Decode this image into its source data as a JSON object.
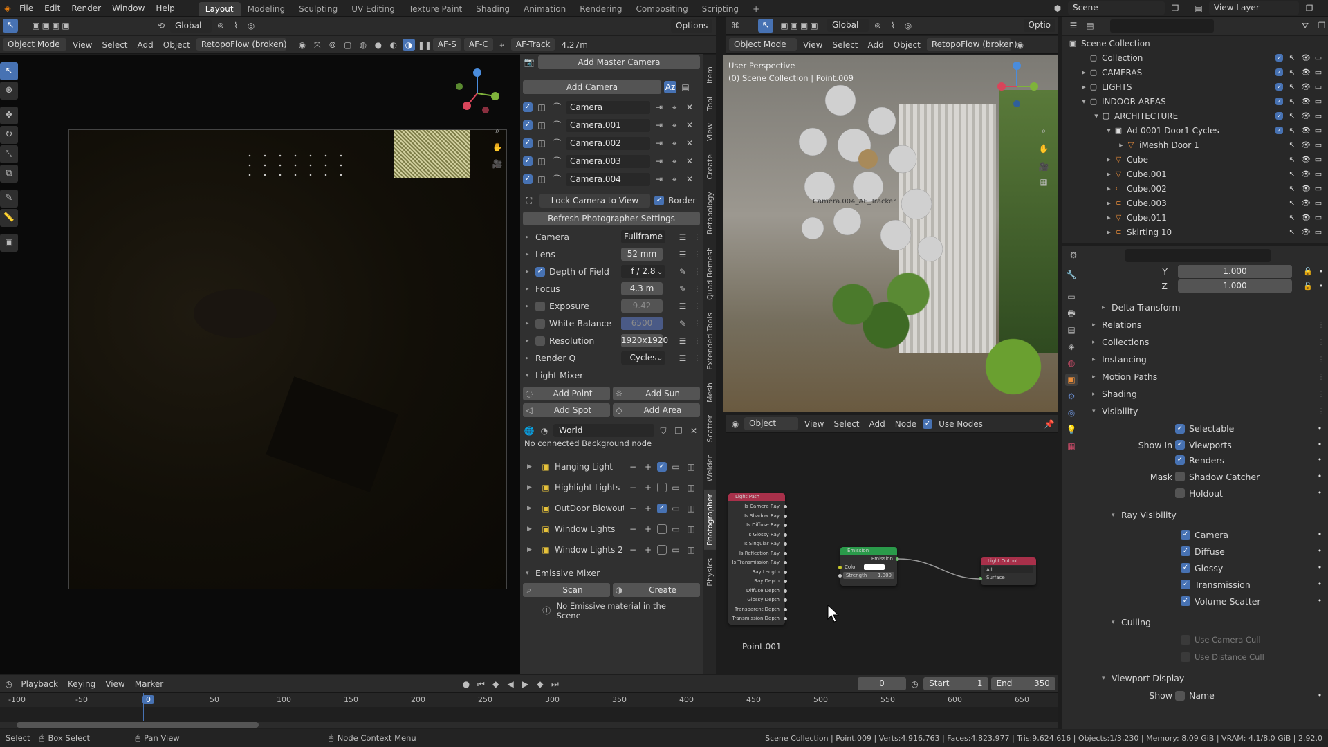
{
  "topbar": {
    "menus": [
      "File",
      "Edit",
      "Render",
      "Window",
      "Help"
    ],
    "workspaces": [
      "Layout",
      "Modeling",
      "Sculpting",
      "UV Editing",
      "Texture Paint",
      "Shading",
      "Animation",
      "Rendering",
      "Compositing",
      "Scripting"
    ],
    "add_workspace": "+",
    "scene": "Scene",
    "view_layer": "View Layer"
  },
  "left_header": {
    "mode": "Object Mode",
    "menus": [
      "View",
      "Select",
      "Add",
      "Object"
    ],
    "retopo": "RetopoFlow (broken)",
    "transform": "Global",
    "af_s": "AF-S",
    "af_c": "AF-C",
    "af_track": "AF-Track",
    "distance": "4.27m",
    "options": "Options"
  },
  "right_header": {
    "transform": "Global",
    "mode": "Object Mode",
    "menus": [
      "View",
      "Select",
      "Add",
      "Object"
    ],
    "retopo": "RetopoFlow (broken)",
    "options": "Optio",
    "overlay_top": "User Perspective",
    "overlay_sub": "(0) Scene Collection | Point.009",
    "tracker_label": "Camera.004_AF_Tracker"
  },
  "photographer": {
    "add_master": "Add Master Camera",
    "add_camera": "Add Camera",
    "cameras": [
      "Camera",
      "Camera.001",
      "Camera.002",
      "Camera.003",
      "Camera.004"
    ],
    "lock_camera": "Lock Camera to View",
    "border": "Border",
    "refresh": "Refresh Photographer Settings",
    "props": [
      {
        "label": "Camera",
        "value": "Fullframe",
        "check": false,
        "dropdown": true,
        "dim": false
      },
      {
        "label": "Lens",
        "value": "52 mm",
        "check": false,
        "dropdown": false,
        "dim": false
      },
      {
        "label": "Depth of Field",
        "value": "f / 2.8",
        "check": true,
        "dropdown": true,
        "dim": false
      },
      {
        "label": "Focus",
        "value": "4.3 m",
        "check": false,
        "dropdown": false,
        "dim": false
      },
      {
        "label": "Exposure",
        "value": "9.42",
        "check": "off",
        "dropdown": false,
        "dim": true
      },
      {
        "label": "White Balance",
        "value": "6500",
        "check": "off",
        "dropdown": false,
        "dim": true
      },
      {
        "label": "Resolution",
        "value": "1920x1920",
        "check": "off",
        "dropdown": false,
        "dim": false
      },
      {
        "label": "Render Q",
        "value": "Cycles",
        "check": false,
        "dropdown": true,
        "dim": false
      }
    ],
    "light_mixer": "Light Mixer",
    "add_point": "Add Point",
    "add_sun": "Add Sun",
    "add_spot": "Add Spot",
    "add_area": "Add Area",
    "world": "World",
    "no_bg": "No connected Background node",
    "lights": [
      {
        "name": "Hanging Light",
        "checked": true
      },
      {
        "name": "Highlight Lights",
        "checked": false
      },
      {
        "name": "OutDoor Blowout ...",
        "checked": true
      },
      {
        "name": "Window Lights",
        "checked": false
      },
      {
        "name": "Window Lights 2",
        "checked": false
      }
    ],
    "emissive_mixer": "Emissive Mixer",
    "scan": "Scan",
    "create": "Create",
    "no_emissive": "No Emissive material in the Scene",
    "side_tabs": [
      "Item",
      "Tool",
      "View",
      "Create",
      "Retopology",
      "Quad Remesh",
      "Extended Tools",
      "Mesh",
      "Scatter",
      "Welder",
      "Photographer",
      "Physics"
    ]
  },
  "node_editor": {
    "type": "Object",
    "menus": [
      "View",
      "Select",
      "Add",
      "Node"
    ],
    "use_nodes": "Use Nodes",
    "object_label": "Point.001",
    "light_path": {
      "title": "Light Path",
      "outputs": [
        "Is Camera Ray",
        "Is Shadow Ray",
        "Is Diffuse Ray",
        "Is Glossy Ray",
        "Is Singular Ray",
        "Is Reflection Ray",
        "Is Transmission Ray",
        "Ray Length",
        "Ray Depth",
        "Diffuse Depth",
        "Glossy Depth",
        "Transparent Depth",
        "Transmission Depth"
      ]
    },
    "emission": {
      "title": "Emission",
      "output": "Emission",
      "color": "Color",
      "strength": "Strength",
      "strength_val": "1.000"
    },
    "light_output": {
      "title": "Light Output",
      "target": "All",
      "surface": "Surface"
    }
  },
  "timeline": {
    "menus": [
      "Playback",
      "Keying",
      "View",
      "Marker"
    ],
    "current": "0",
    "start_label": "Start",
    "start": "1",
    "end_label": "End",
    "end": "350",
    "ruler": [
      "-100",
      "-50",
      "0",
      "50",
      "100",
      "150",
      "200",
      "250",
      "300",
      "350",
      "400",
      "450",
      "500",
      "550",
      "600",
      "650"
    ]
  },
  "outliner": {
    "root": "Scene Collection",
    "rows": [
      {
        "name": "Collection",
        "depth": 1,
        "arrow": ""
      },
      {
        "name": "CAMERAS",
        "depth": 1,
        "arrow": "▸"
      },
      {
        "name": "LIGHTS",
        "depth": 1,
        "arrow": "▸"
      },
      {
        "name": "INDOOR AREAS",
        "depth": 1,
        "arrow": "▾"
      },
      {
        "name": "ARCHITECTURE",
        "depth": 2,
        "arrow": "▾"
      },
      {
        "name": "Ad-0001 Door1 Cycles",
        "depth": 3,
        "arrow": "▾"
      },
      {
        "name": "iMeshh Door 1",
        "depth": 4,
        "arrow": "▸"
      },
      {
        "name": "Cube",
        "depth": 3,
        "arrow": "▸"
      },
      {
        "name": "Cube.001",
        "depth": 3,
        "arrow": "▸"
      },
      {
        "name": "Cube.002",
        "depth": 3,
        "arrow": "▸"
      },
      {
        "name": "Cube.003",
        "depth": 3,
        "arrow": "▸"
      },
      {
        "name": "Cube.011",
        "depth": 3,
        "arrow": "▸"
      },
      {
        "name": "Skirting 10",
        "depth": 3,
        "arrow": "▸"
      }
    ]
  },
  "properties": {
    "y_label": "Y",
    "y_val": "1.000",
    "z_label": "Z",
    "z_val": "1.000",
    "sections": [
      "Delta Transform",
      "Relations",
      "Collections",
      "Instancing",
      "Motion Paths",
      "Shading",
      "Visibility"
    ],
    "selectable": "Selectable",
    "show_in": "Show In",
    "viewports": "Viewports",
    "renders": "Renders",
    "mask": "Mask",
    "shadow_catcher": "Shadow Catcher",
    "holdout": "Holdout",
    "ray_visibility": "Ray Visibility",
    "rays": [
      "Camera",
      "Diffuse",
      "Glossy",
      "Transmission",
      "Volume Scatter"
    ],
    "culling": "Culling",
    "use_camera_cull": "Use Camera Cull",
    "use_distance_cull": "Use Distance Cull",
    "viewport_display": "Viewport Display",
    "show": "Show",
    "name": "Name"
  },
  "status": {
    "select": "Select",
    "box_select": "Box Select",
    "pan_view": "Pan View",
    "node_context": "Node Context Menu",
    "stats": "Scene Collection | Point.009 | Verts:4,916,763 | Faces:4,823,977 | Tris:9,624,616 | Objects:1/3,230 | Memory: 8.09 GiB | VRAM: 4.1/8.0 GiB | 2.92.0"
  }
}
